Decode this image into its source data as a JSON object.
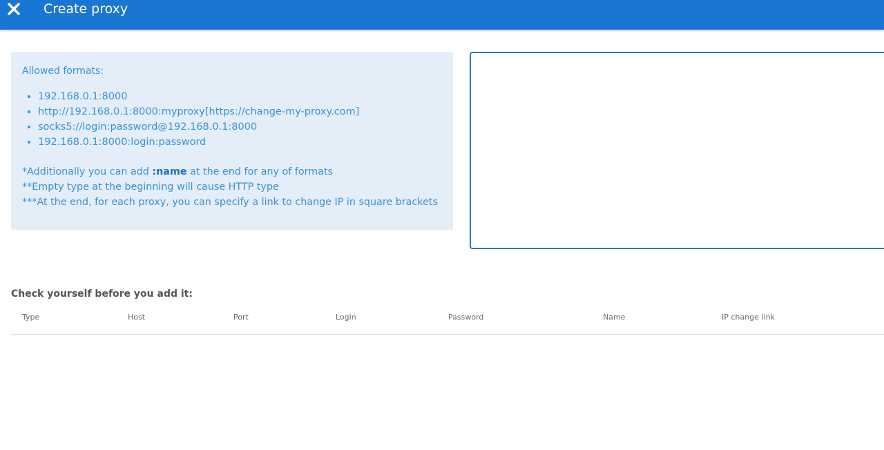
{
  "header": {
    "title": "Create proxy",
    "close_icon": "close-icon",
    "background": "#1976d2"
  },
  "info": {
    "heading": "Allowed formats:",
    "formats": [
      "192.168.0.1:8000",
      "http://192.168.0.1:8000:myproxy[https://change-my-proxy.com]",
      "socks5://login:password@192.168.0.1:8000",
      "192.168.0.1:8000:login:password"
    ],
    "note1_prefix": "*Additionally you can add ",
    "note1_bold": ":name",
    "note1_suffix": " at the end for any of formats",
    "note2": "**Empty type at the beginning will cause HTTP type",
    "note3": "***At the end, for each proxy, you can specify a link to change IP in square brackets",
    "background": "#e3eef9",
    "text_color": "#3d8fd6"
  },
  "proxy_input": {
    "value": "",
    "placeholder": ""
  },
  "check": {
    "title": "Check yourself before you add it:",
    "columns": [
      "Type",
      "Host",
      "Port",
      "Login",
      "Password",
      "Name",
      "IP change link"
    ],
    "rows": []
  }
}
